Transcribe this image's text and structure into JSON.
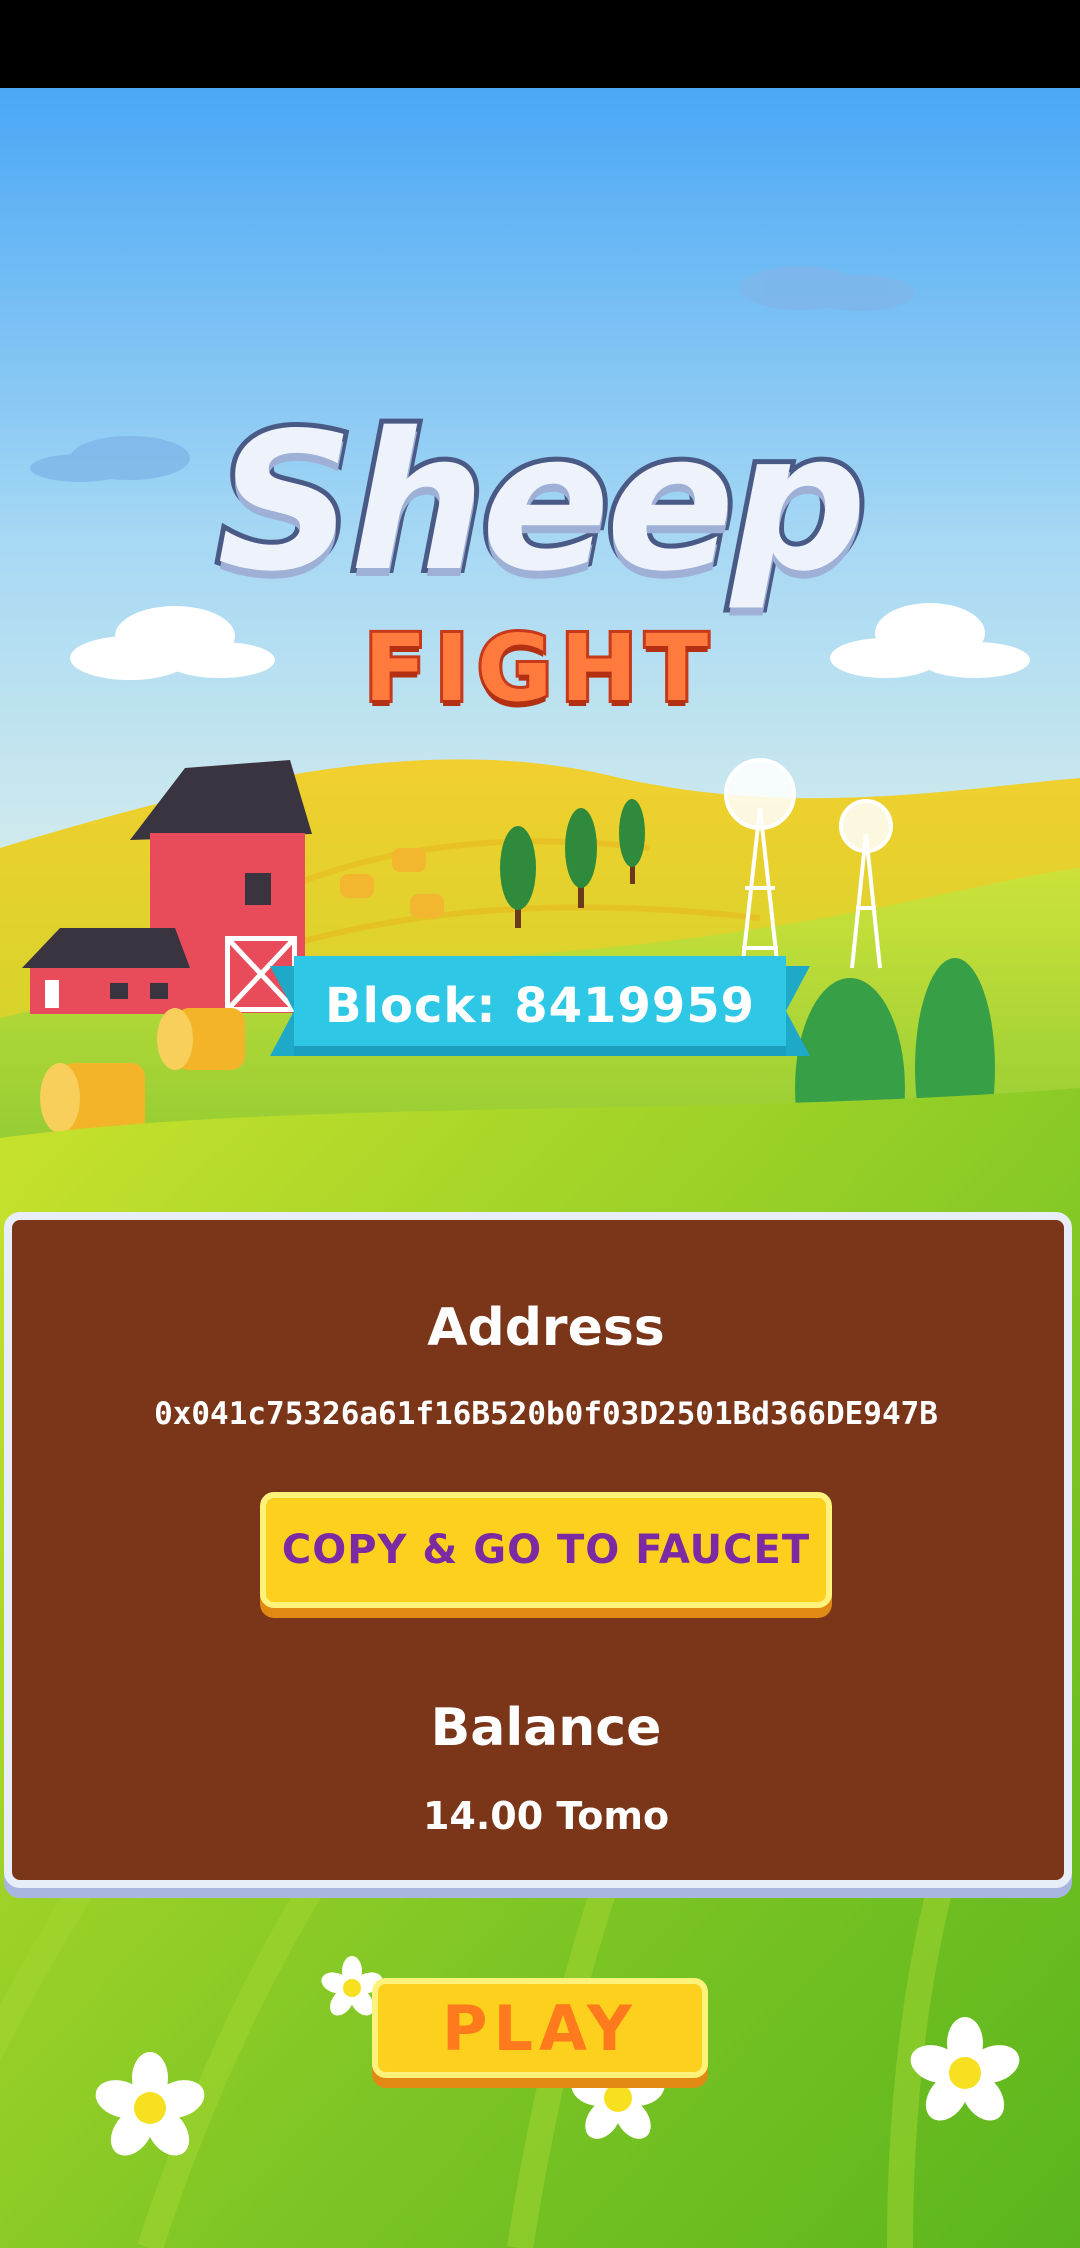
{
  "game": {
    "logo_line1": "Sheep",
    "logo_line2": "FIGHT"
  },
  "block": {
    "label": "Block: 8419959"
  },
  "wallet": {
    "address_title": "Address",
    "address_value": "0x041c75326a61f16B520b0f03D2501Bd366DE947B",
    "faucet_button_label": "COPY & GO TO FAUCET",
    "balance_title": "Balance",
    "balance_value": "14.00 Tomo"
  },
  "actions": {
    "play_label": "PLAY"
  },
  "colors": {
    "sky_top": "#4aa7f5",
    "panel_bg": "#7b3519",
    "button_yellow": "#fcd01d",
    "faucet_text": "#7b2aa3",
    "play_text": "#ff7a1c",
    "ribbon": "#2ec8e6"
  }
}
